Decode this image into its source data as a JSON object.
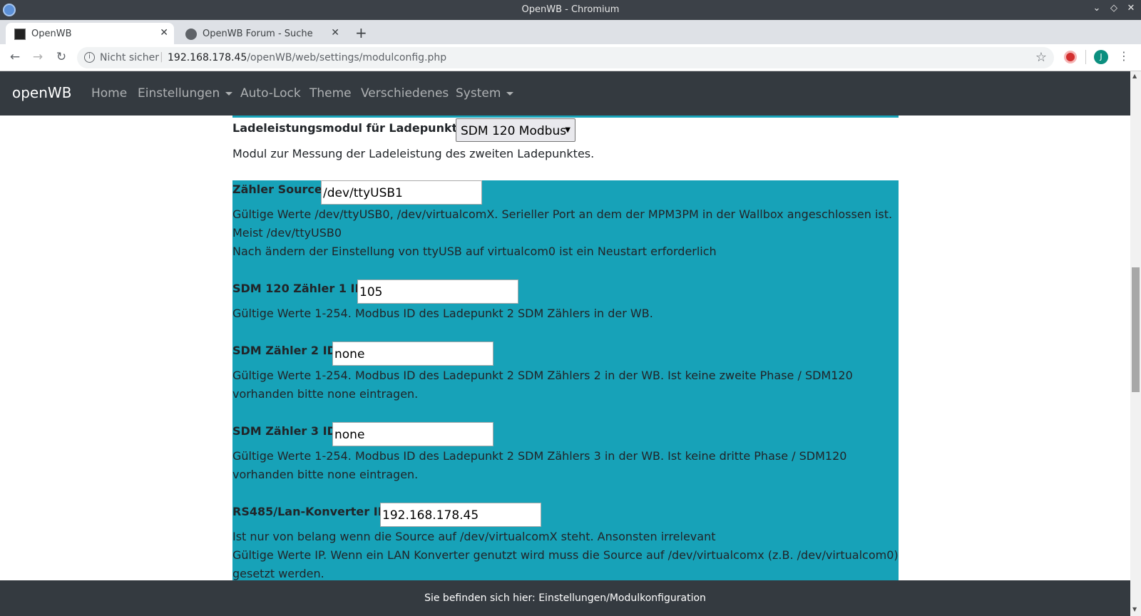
{
  "window": {
    "title": "OpenWB - Chromium"
  },
  "tabs": [
    {
      "label": "OpenWB",
      "active": true
    },
    {
      "label": "OpenWB Forum - Suche",
      "active": false
    }
  ],
  "toolbar": {
    "security_text": "Nicht sicher",
    "url_host": "192.168.178.45",
    "url_path": "/openWB/web/settings/modulconfig.php",
    "avatar_initial": "J"
  },
  "nav": {
    "brand": "openWB",
    "items": [
      {
        "label": "Home",
        "dropdown": false
      },
      {
        "label": "Einstellungen",
        "dropdown": true
      },
      {
        "label": "Auto-Lock",
        "dropdown": false
      },
      {
        "label": "Theme",
        "dropdown": false
      },
      {
        "label": "Verschiedenes",
        "dropdown": false
      },
      {
        "label": "System",
        "dropdown": true
      }
    ]
  },
  "module": {
    "label": "Ladeleistungsmodul für Ladepunkt 2:",
    "selected": "SDM 120 Modbus",
    "description": "Modul zur Messung der Ladeleistung des zweiten Ladepunktes."
  },
  "fields": {
    "source": {
      "label": "Zähler Source:",
      "value": "/dev/ttyUSB1",
      "help": [
        "Gültige Werte /dev/ttyUSB0, /dev/virtualcomX. Serieller Port an dem der MPM3PM in der Wallbox angeschlossen ist.",
        "Meist /dev/ttyUSB0",
        "Nach ändern der Einstellung von ttyUSB auf virtualcom0 ist ein Neustart erforderlich"
      ]
    },
    "sdm1": {
      "label": "SDM 120 Zähler 1 ID:",
      "value": "105",
      "help": [
        "Gültige Werte 1-254. Modbus ID des Ladepunkt 2 SDM Zählers in der WB."
      ]
    },
    "sdm2": {
      "label": "SDM Zähler 2 ID:",
      "value": "none",
      "help": [
        "Gültige Werte 1-254. Modbus ID des Ladepunkt 2 SDM Zählers 2 in der WB. Ist keine zweite Phase / SDM120",
        "vorhanden bitte none eintragen."
      ]
    },
    "sdm3": {
      "label": "SDM Zähler 3 ID:",
      "value": "none",
      "help": [
        "Gültige Werte 1-254. Modbus ID des Ladepunkt 2 SDM Zählers 3 in der WB. Ist keine dritte Phase / SDM120",
        "vorhanden bitte none eintragen."
      ]
    },
    "rs485": {
      "label": "RS485/Lan-Konverter IP:",
      "value": "192.168.178.45",
      "help": [
        "Ist nur von belang wenn die Source auf /dev/virtualcomX steht. Ansonsten irrelevant",
        "Gültige Werte IP. Wenn ein LAN Konverter genutzt wird muss die Source auf /dev/virtualcomx (z.B. /dev/virtualcom0)",
        "gesetzt werden."
      ]
    }
  },
  "footer": {
    "text": "Sie befinden sich hier: Einstellungen/Modulkonfiguration"
  },
  "colors": {
    "navbar": "#343a40",
    "panel": "#17a2b8"
  }
}
